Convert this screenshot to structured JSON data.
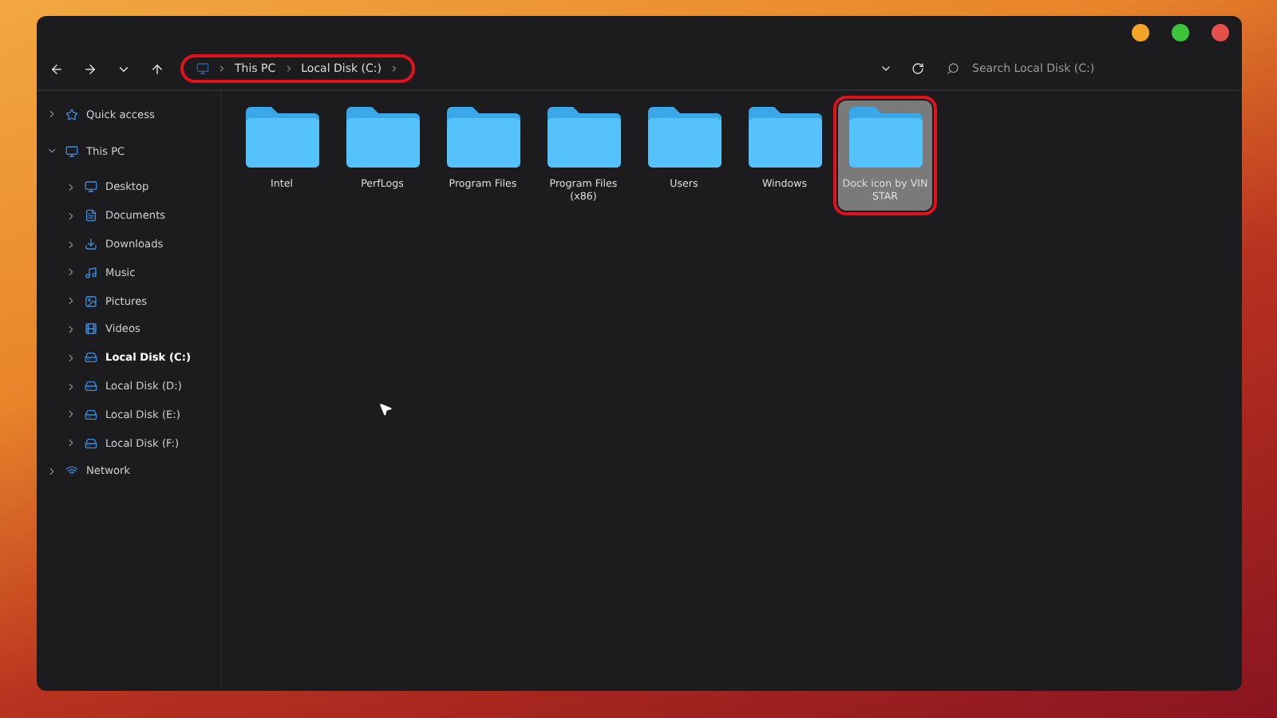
{
  "breadcrumb": [
    {
      "label": "This PC"
    },
    {
      "label": "Local Disk (C:)"
    }
  ],
  "search": {
    "placeholder": "Search Local Disk (C:)"
  },
  "sidebar": {
    "items": [
      {
        "label": "Quick access",
        "kind": "star",
        "expanded": false,
        "selected": false
      },
      {
        "label": "This PC",
        "kind": "pc",
        "expanded": true,
        "selected": false,
        "children": [
          {
            "label": "Desktop",
            "kind": "desktop",
            "expanded": false,
            "selected": false
          },
          {
            "label": "Documents",
            "kind": "doc",
            "expanded": false,
            "selected": false
          },
          {
            "label": "Downloads",
            "kind": "download",
            "expanded": false,
            "selected": false
          },
          {
            "label": "Music",
            "kind": "music",
            "expanded": false,
            "selected": false
          },
          {
            "label": "Pictures",
            "kind": "picture",
            "expanded": false,
            "selected": false
          },
          {
            "label": "Videos",
            "kind": "video",
            "expanded": false,
            "selected": false
          },
          {
            "label": "Local Disk (C:)",
            "kind": "disk",
            "expanded": false,
            "selected": true
          },
          {
            "label": "Local Disk (D:)",
            "kind": "disk",
            "expanded": false,
            "selected": false
          },
          {
            "label": "Local Disk (E:)",
            "kind": "disk",
            "expanded": false,
            "selected": false
          },
          {
            "label": "Local Disk (F:)",
            "kind": "disk",
            "expanded": false,
            "selected": false
          }
        ]
      },
      {
        "label": "Network",
        "kind": "network",
        "expanded": false,
        "selected": false
      }
    ]
  },
  "folders": [
    {
      "name": "Intel",
      "selected": false
    },
    {
      "name": "PerfLogs",
      "selected": false
    },
    {
      "name": "Program Files",
      "selected": false
    },
    {
      "name": "Program Files (x86)",
      "selected": false
    },
    {
      "name": "Users",
      "selected": false
    },
    {
      "name": "Windows",
      "selected": false
    },
    {
      "name": "Dock icon by VIN STAR",
      "selected": true
    }
  ]
}
